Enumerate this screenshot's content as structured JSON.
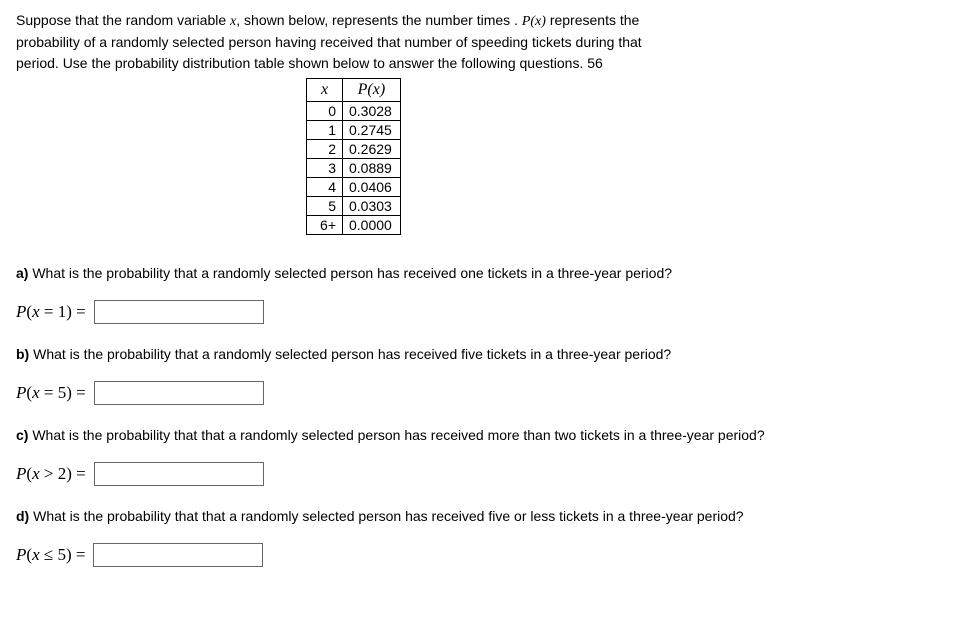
{
  "intro": {
    "line1": "Suppose that the random variable ",
    "varx": "x",
    "line1b": ", shown below, represents the number times . ",
    "Px": "P(x)",
    "line1c": " represents the",
    "line2": "probability of a randomly selected person having received that number of speeding tickets during that",
    "line3": "period. Use the probability distribution table shown below to answer the following questions. 56"
  },
  "table": {
    "header_x": "x",
    "header_px": "P(x)",
    "rows": [
      {
        "x": "0",
        "px": "0.3028"
      },
      {
        "x": "1",
        "px": "0.2745"
      },
      {
        "x": "2",
        "px": "0.2629"
      },
      {
        "x": "3",
        "px": "0.0889"
      },
      {
        "x": "4",
        "px": "0.0406"
      },
      {
        "x": "5",
        "px": "0.0303"
      },
      {
        "x": "6+",
        "px": "0.0000"
      }
    ]
  },
  "qa": {
    "label": "a)",
    "text": " What is the probability that a randomly selected person has received one tickets in a three-year period?",
    "math": "P(x = 1) ="
  },
  "qb": {
    "label": "b)",
    "text": " What is the probability that a randomly selected person has received five tickets in a three-year period?",
    "math": "P(x = 5) ="
  },
  "qc": {
    "label": "c)",
    "text": " What is the probability that that a randomly selected person has received more than two tickets in a three-year period?",
    "math": "P(x > 2) ="
  },
  "qd": {
    "label": "d)",
    "text": " What is the probability that that a randomly selected person has received five or less tickets in a three-year period?",
    "math": "P(x ≤ 5) ="
  }
}
